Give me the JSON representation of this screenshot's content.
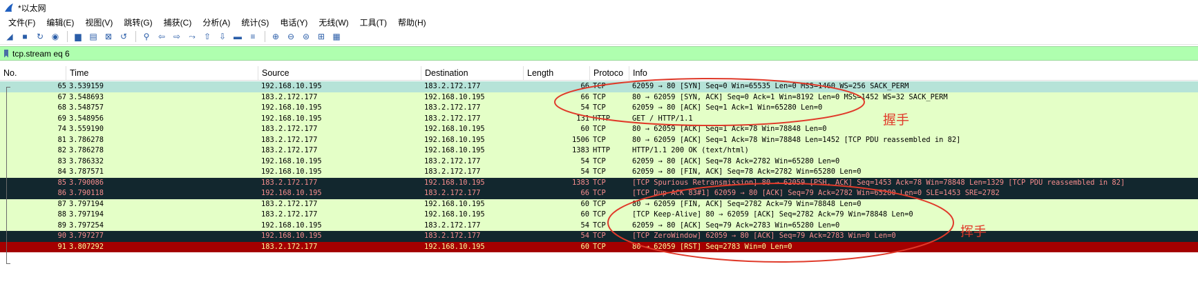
{
  "window": {
    "title": "*以太网"
  },
  "menu": [
    "文件(F)",
    "编辑(E)",
    "视图(V)",
    "跳转(G)",
    "捕获(C)",
    "分析(A)",
    "统计(S)",
    "电话(Y)",
    "无线(W)",
    "工具(T)",
    "帮助(H)"
  ],
  "toolbar": {
    "icons": [
      "shark-fin-start-icon",
      "stop-square-icon",
      "restart-shark-icon",
      "capture-options-gear-icon",
      "open-folder-icon",
      "save-file-icon",
      "close-file-icon",
      "reload-icon",
      "find-magnifier-icon",
      "back-arrow-icon",
      "forward-arrow-icon",
      "goto-packet-icon",
      "first-packet-icon",
      "last-packet-icon",
      "autoscroll-icon",
      "colorize-lines-icon",
      "zoom-in-icon",
      "zoom-out-icon",
      "zoom-normal-icon",
      "resize-columns-icon",
      "layout-grid-icon"
    ],
    "glyphs": [
      "◢",
      "■",
      "↻",
      "◉",
      "▆",
      "▤",
      "⊠",
      "↺",
      "⚲",
      "⇦",
      "⇨",
      "⤳",
      "⇧",
      "⇩",
      "▬",
      "≡",
      "⊕",
      "⊖",
      "⊜",
      "⊞",
      "▦"
    ]
  },
  "filter": {
    "text": "tcp.stream eq 6"
  },
  "columns": {
    "no": "No.",
    "time": "Time",
    "source": "Source",
    "destination": "Destination",
    "length": "Length",
    "protocol": "Protoco",
    "info": "Info"
  },
  "packets": [
    {
      "no": "65",
      "time": "3.539159",
      "src": "192.168.10.195",
      "dst": "183.2.172.177",
      "len": "66",
      "proto": "TCP",
      "info": "62059 → 80 [SYN] Seq=0 Win=65535 Len=0 MSS=1460 WS=256 SACK_PERM",
      "style": "sel"
    },
    {
      "no": "67",
      "time": "3.548693",
      "src": "183.2.172.177",
      "dst": "192.168.10.195",
      "len": "66",
      "proto": "TCP",
      "info": "80 → 62059 [SYN, ACK] Seq=0 Ack=1 Win=8192 Len=0 MSS=1452 WS=32 SACK_PERM",
      "style": "green"
    },
    {
      "no": "68",
      "time": "3.548757",
      "src": "192.168.10.195",
      "dst": "183.2.172.177",
      "len": "54",
      "proto": "TCP",
      "info": "62059 → 80 [ACK] Seq=1 Ack=1 Win=65280 Len=0",
      "style": "green"
    },
    {
      "no": "69",
      "time": "3.548956",
      "src": "192.168.10.195",
      "dst": "183.2.172.177",
      "len": "131",
      "proto": "HTTP",
      "info": "GET / HTTP/1.1",
      "style": "green"
    },
    {
      "no": "74",
      "time": "3.559190",
      "src": "183.2.172.177",
      "dst": "192.168.10.195",
      "len": "60",
      "proto": "TCP",
      "info": "80 → 62059 [ACK] Seq=1 Ack=78 Win=78848 Len=0",
      "style": "green"
    },
    {
      "no": "81",
      "time": "3.786278",
      "src": "183.2.172.177",
      "dst": "192.168.10.195",
      "len": "1506",
      "proto": "TCP",
      "info": "80 → 62059 [ACK] Seq=1 Ack=78 Win=78848 Len=1452 [TCP PDU reassembled in 82]",
      "style": "green"
    },
    {
      "no": "82",
      "time": "3.786278",
      "src": "183.2.172.177",
      "dst": "192.168.10.195",
      "len": "1383",
      "proto": "HTTP",
      "info": "HTTP/1.1 200 OK  (text/html)",
      "style": "green"
    },
    {
      "no": "83",
      "time": "3.786332",
      "src": "192.168.10.195",
      "dst": "183.2.172.177",
      "len": "54",
      "proto": "TCP",
      "info": "62059 → 80 [ACK] Seq=78 Ack=2782 Win=65280 Len=0",
      "style": "green"
    },
    {
      "no": "84",
      "time": "3.787571",
      "src": "192.168.10.195",
      "dst": "183.2.172.177",
      "len": "54",
      "proto": "TCP",
      "info": "62059 → 80 [FIN, ACK] Seq=78 Ack=2782 Win=65280 Len=0",
      "style": "green"
    },
    {
      "no": "85",
      "time": "3.790086",
      "src": "183.2.172.177",
      "dst": "192.168.10.195",
      "len": "1383",
      "proto": "TCP",
      "info": "[TCP Spurious Retransmission] 80 → 62059 [PSH, ACK] Seq=1453 Ack=78 Win=78848 Len=1329 [TCP PDU reassembled in 82]",
      "style": "dark"
    },
    {
      "no": "86",
      "time": "3.790118",
      "src": "192.168.10.195",
      "dst": "183.2.172.177",
      "len": "66",
      "proto": "TCP",
      "info": "[TCP Dup ACK 83#1] 62059 → 80 [ACK] Seq=79 Ack=2782 Win=65280 Len=0 SLE=1453 SRE=2782",
      "style": "dark"
    },
    {
      "no": "87",
      "time": "3.797194",
      "src": "183.2.172.177",
      "dst": "192.168.10.195",
      "len": "60",
      "proto": "TCP",
      "info": "80 → 62059 [FIN, ACK] Seq=2782 Ack=79 Win=78848 Len=0",
      "style": "green"
    },
    {
      "no": "88",
      "time": "3.797194",
      "src": "183.2.172.177",
      "dst": "192.168.10.195",
      "len": "60",
      "proto": "TCP",
      "info": "[TCP Keep-Alive] 80 → 62059 [ACK] Seq=2782 Ack=79 Win=78848 Len=0",
      "style": "green"
    },
    {
      "no": "89",
      "time": "3.797254",
      "src": "192.168.10.195",
      "dst": "183.2.172.177",
      "len": "54",
      "proto": "TCP",
      "info": "62059 → 80 [ACK] Seq=79 Ack=2783 Win=65280 Len=0",
      "style": "green"
    },
    {
      "no": "90",
      "time": "3.797277",
      "src": "192.168.10.195",
      "dst": "183.2.172.177",
      "len": "54",
      "proto": "TCP",
      "info": "[TCP ZeroWindow] 62059 → 80 [ACK] Seq=79 Ack=2783 Win=0 Len=0",
      "style": "dark"
    },
    {
      "no": "91",
      "time": "3.807292",
      "src": "183.2.172.177",
      "dst": "192.168.10.195",
      "len": "60",
      "proto": "TCP",
      "info": "80 → 62059 [RST] Seq=2783 Win=0 Len=0",
      "style": "red"
    }
  ],
  "annotations": {
    "handshake": "握手",
    "wave": "挥手"
  },
  "colors": {
    "annotation": "#e03a2a",
    "filter_bg": "#afffaf",
    "row_green": "#e4ffc7",
    "row_selected": "#b6e3d8",
    "row_dark": "#12272e",
    "row_red": "#a40000"
  }
}
